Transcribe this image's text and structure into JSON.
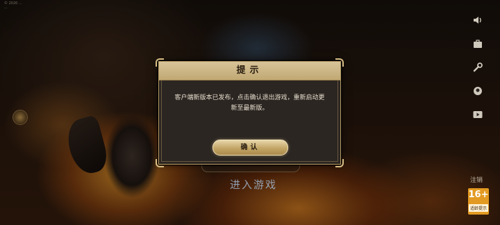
{
  "background": {
    "copyright_lines": [
      "© 2020 ... ",
      "..."
    ],
    "enter_game_label": "进入游戏",
    "server_button_label": "",
    "logout_label": "注销",
    "age_rating": {
      "number": "16+",
      "tip": "适龄提示"
    }
  },
  "right_toolbar": [
    {
      "icon": "speaker-icon"
    },
    {
      "icon": "briefcase-icon"
    },
    {
      "icon": "wrench-icon"
    },
    {
      "icon": "location-icon"
    },
    {
      "icon": "video-icon"
    }
  ],
  "dialog": {
    "title": "提示",
    "message": "客户端新版本已发布，点击确认退出游戏，重新启动更新至最新版。",
    "confirm_label": "确认"
  },
  "colors": {
    "dialog_bg": "#2b2622",
    "dialog_border": "#b59a63",
    "header_gold": "#d8c49a",
    "button_gold": "#c3a566",
    "age_badge": "#e39a22"
  }
}
